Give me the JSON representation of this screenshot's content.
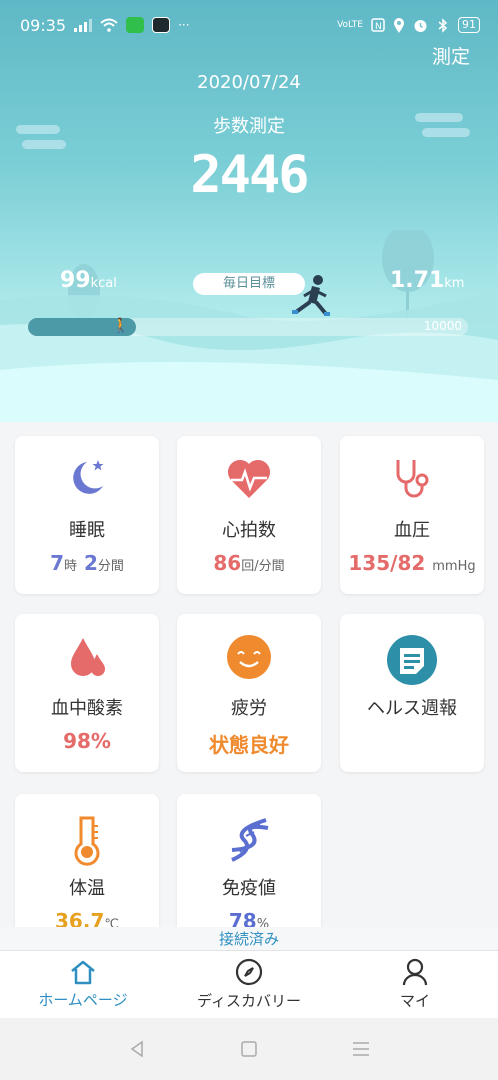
{
  "status_bar": {
    "time": "09:35",
    "battery": "91",
    "network": "VoLTE"
  },
  "header": {
    "measure_link": "測定",
    "date": "2020/07/24",
    "title": "歩数測定",
    "steps": "2446",
    "kcal_value": "99",
    "kcal_unit": "kcal",
    "distance_value": "1.71",
    "distance_unit": "km",
    "goal_label": "毎日目標",
    "goal_max": "10000",
    "progress_fraction": 0.2446
  },
  "cards": [
    {
      "title": "睡眠",
      "icon": "moon-star-icon",
      "value_parts": [
        "7",
        "時",
        "2",
        "分間"
      ],
      "color": "#6a78d1"
    },
    {
      "title": "心拍数",
      "icon": "heart-pulse-icon",
      "value": "86",
      "unit": "回/分間",
      "color": "#e56a6a"
    },
    {
      "title": "血圧",
      "icon": "stethoscope-icon",
      "value": "135/82",
      "unit": "mmHg",
      "color": "#e56a6a"
    },
    {
      "title": "血中酸素",
      "icon": "blood-drops-icon",
      "value": "98%",
      "color": "#e56a6a"
    },
    {
      "title": "疲労",
      "icon": "smile-face-icon",
      "value": "状態良好",
      "color": "#f08a2e"
    },
    {
      "title": "ヘルス週報",
      "icon": "report-icon",
      "color": "#2e8fa8"
    },
    {
      "title": "体温",
      "icon": "thermometer-icon",
      "value": "36.7",
      "unit": "℃",
      "color": "#e8a020"
    },
    {
      "title": "免疫値",
      "icon": "dna-icon",
      "value": "78",
      "unit": "%",
      "color": "#5a6fd0"
    }
  ],
  "connection_status": "接続済み",
  "nav": {
    "home": "ホームページ",
    "discovery": "ディスカバリー",
    "my": "マイ"
  },
  "colors": {
    "accent": "#2e8fc0",
    "header_top": "#5fb8c6",
    "header_bottom": "#d8fbfb"
  }
}
